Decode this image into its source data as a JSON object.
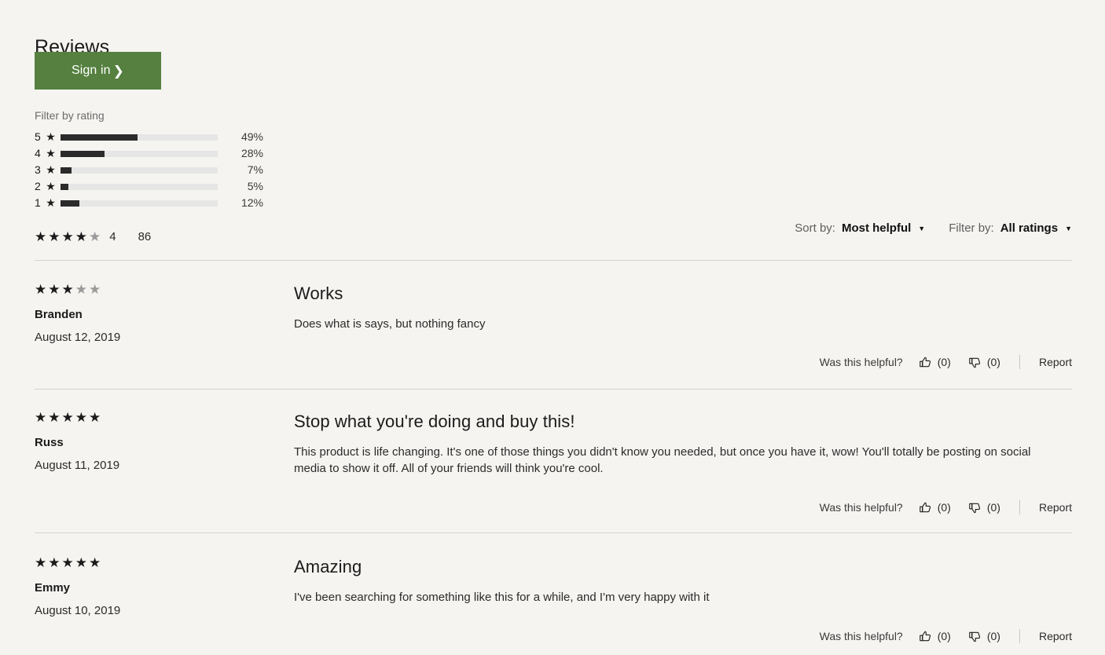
{
  "header": {
    "title": "Reviews",
    "sign_in_label": "Sign in",
    "sign_in_chevron": "chevron-right-icon"
  },
  "filter_panel": {
    "label": "Filter by rating",
    "rows": [
      {
        "stars": "5",
        "percent_label": "49%",
        "percent": 49
      },
      {
        "stars": "4",
        "percent_label": "28%",
        "percent": 28
      },
      {
        "stars": "3",
        "percent_label": "7%",
        "percent": 7
      },
      {
        "stars": "2",
        "percent_label": "5%",
        "percent": 5
      },
      {
        "stars": "1",
        "percent_label": "12%",
        "percent": 12
      }
    ]
  },
  "aggregate": {
    "filled_stars": 4,
    "total_stars": 5,
    "rating_value": "4",
    "review_count": "86"
  },
  "controls": {
    "sort_label": "Sort by:",
    "sort_value": "Most helpful",
    "filter_label": "Filter by:",
    "filter_value": "All ratings",
    "caret_icon": "chevron-down-icon"
  },
  "helpful": {
    "question": "Was this helpful?",
    "thumbs_up_icon": "thumbs-up-icon",
    "thumbs_down_icon": "thumbs-down-icon",
    "report_label": "Report"
  },
  "reviews": [
    {
      "rating": 3,
      "author": "Branden",
      "date": "August 12, 2019",
      "title": "Works",
      "text": "Does what is says, but nothing fancy",
      "helpful_yes": "(0)",
      "helpful_no": "(0)"
    },
    {
      "rating": 5,
      "author": "Russ",
      "date": "August 11, 2019",
      "title": "Stop what you're doing and buy this!",
      "text": "This product is life changing. It's one of those things you didn't know you needed, but once you have it, wow! You'll totally be posting on social media to show it off. All of your friends will think you're cool.",
      "helpful_yes": "(0)",
      "helpful_no": "(0)"
    },
    {
      "rating": 5,
      "author": "Emmy",
      "date": "August 10, 2019",
      "title": "Amazing",
      "text": "I've been searching for something like this for a while, and I'm very happy with it",
      "helpful_yes": "(0)",
      "helpful_no": "(0)"
    }
  ],
  "colors": {
    "background": "#f5f4f1",
    "accent_green": "#55803f",
    "bar_fill": "#2b2b2b",
    "bar_track": "#e6e6e6",
    "divider": "#d6d4d1",
    "star_on": "#1b1b1b",
    "star_off": "#9a9a9a"
  }
}
